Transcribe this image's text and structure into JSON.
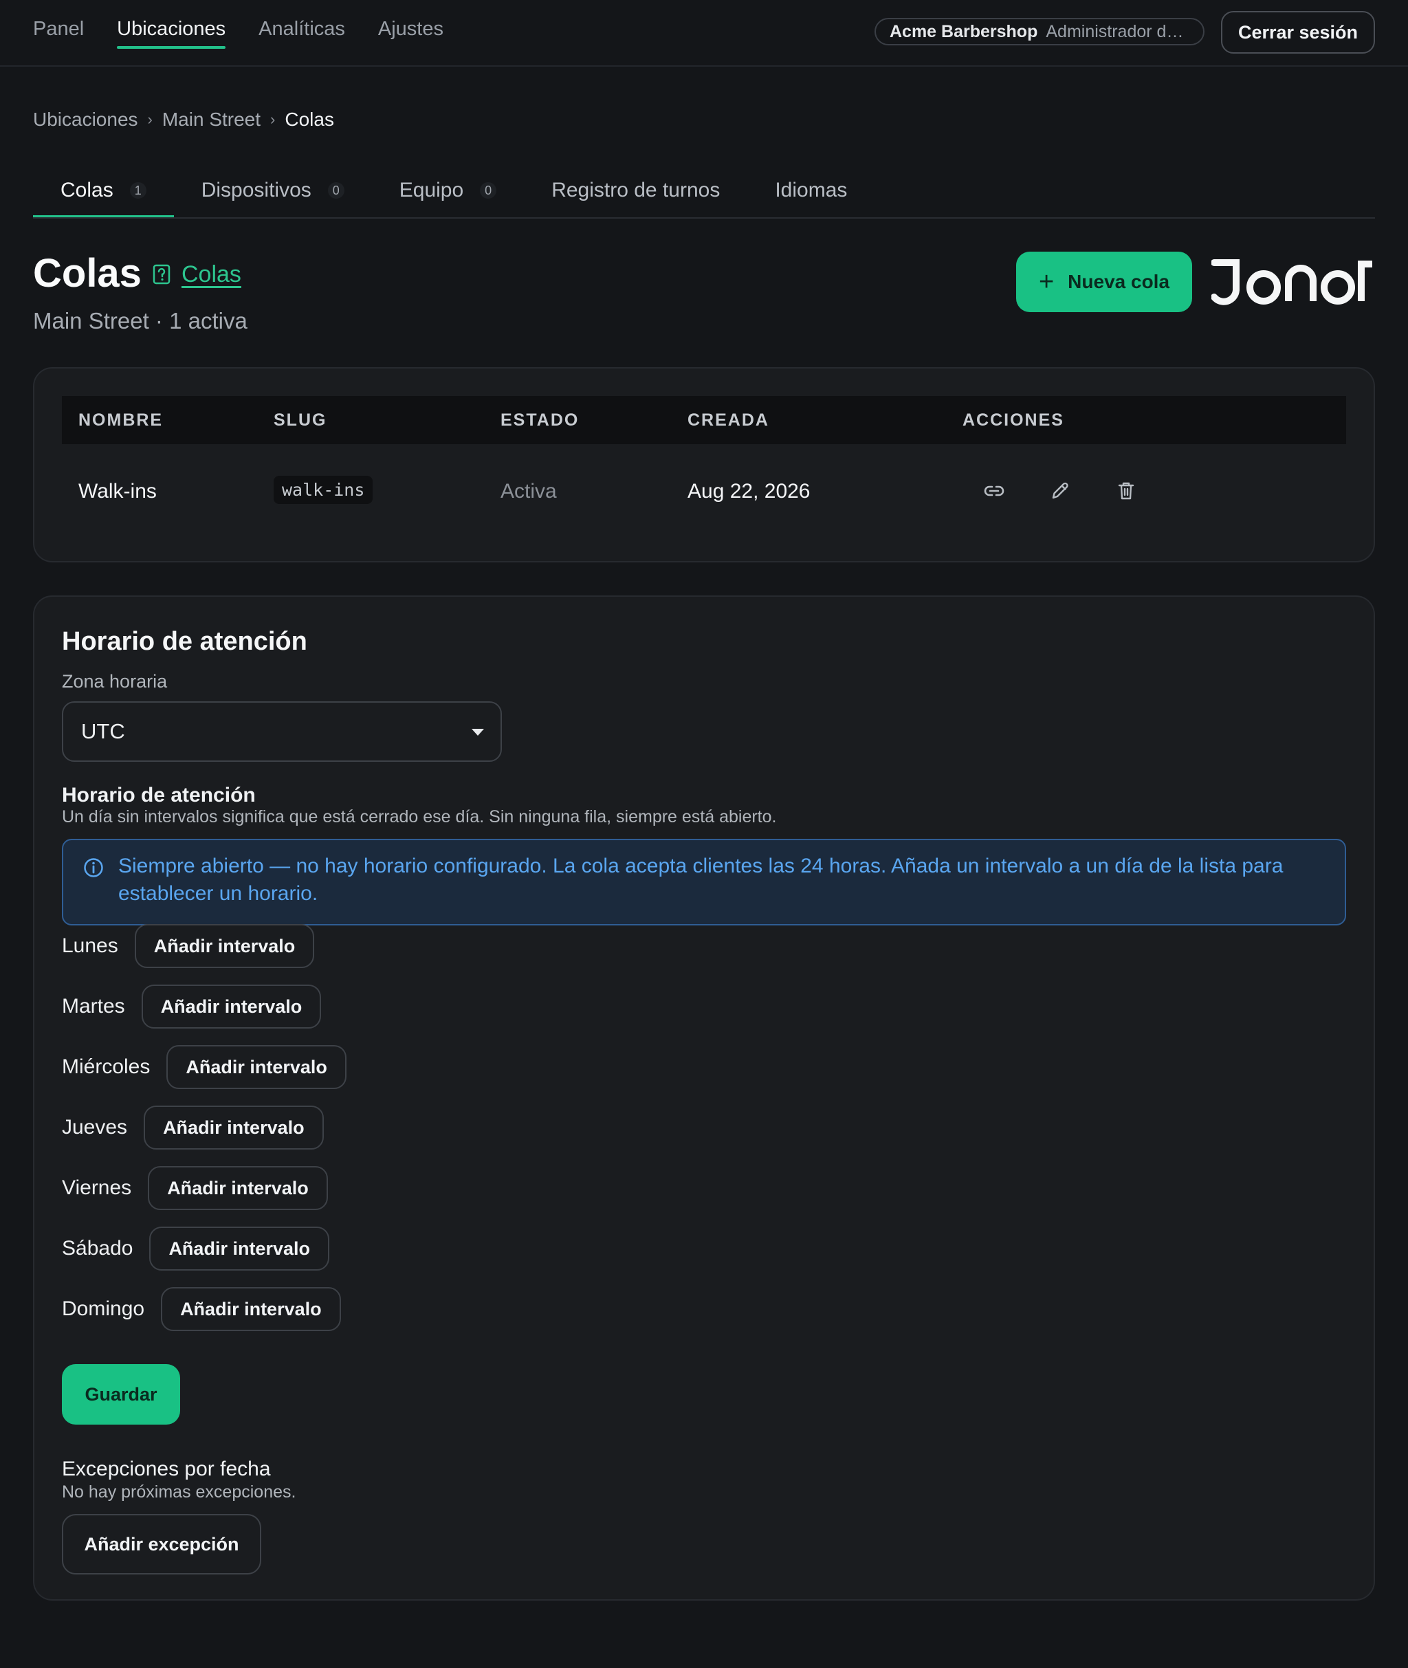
{
  "nav": {
    "links": [
      "Panel",
      "Ubicaciones",
      "Analíticas",
      "Ajustes"
    ],
    "active": "Ubicaciones",
    "org_name": "Acme Barbershop",
    "org_role": "Administrador de...",
    "logout_label": "Cerrar sesión"
  },
  "breadcrumb": {
    "items": [
      "Ubicaciones",
      "Main Street",
      "Colas"
    ],
    "separator": "›"
  },
  "tabs": [
    {
      "label": "Colas",
      "count": "1",
      "active": true
    },
    {
      "label": "Dispositivos",
      "count": "0",
      "active": false
    },
    {
      "label": "Equipo",
      "count": "0",
      "active": false
    },
    {
      "label": "Registro de turnos",
      "count": null,
      "active": false
    },
    {
      "label": "Idiomas",
      "count": null,
      "active": false
    }
  ],
  "header": {
    "title": "Colas",
    "doc_link": "Colas",
    "subtitle": "Main Street · 1 activa",
    "new_button": "Nueva cola",
    "brand": "JONOT"
  },
  "table": {
    "headers": [
      "NOMBRE",
      "SLUG",
      "ESTADO",
      "CREADA",
      "ACCIONES"
    ],
    "rows": [
      {
        "name": "Walk-ins",
        "slug": "walk-ins",
        "status": "Activa",
        "created": "Aug 22, 2026"
      }
    ],
    "actions": [
      "link-icon",
      "pencil-icon",
      "trash-icon"
    ]
  },
  "hours": {
    "title": "Horario de atención",
    "tz_label": "Zona horaria",
    "tz_value": "UTC",
    "section_title": "Horario de atención",
    "section_desc": "Un día sin intervalos significa que está cerrado ese día. Sin ninguna fila, siempre está abierto.",
    "info": "Siempre abierto — no hay horario configurado. La cola acepta clientes las 24 horas. Añada un intervalo a un día de la lista para establecer un horario.",
    "days": [
      "Lunes",
      "Martes",
      "Miércoles",
      "Jueves",
      "Viernes",
      "Sábado",
      "Domingo"
    ],
    "add_interval_label": "Añadir intervalo",
    "save_label": "Guardar",
    "exceptions_title": "Excepciones por fecha",
    "exceptions_desc": "No hay próximas excepciones.",
    "add_exception_label": "Añadir excepción"
  },
  "colors": {
    "accent": "#19c184",
    "info_text": "#5aa6f0",
    "info_bg": "#1b2a3d",
    "background": "#141619"
  }
}
